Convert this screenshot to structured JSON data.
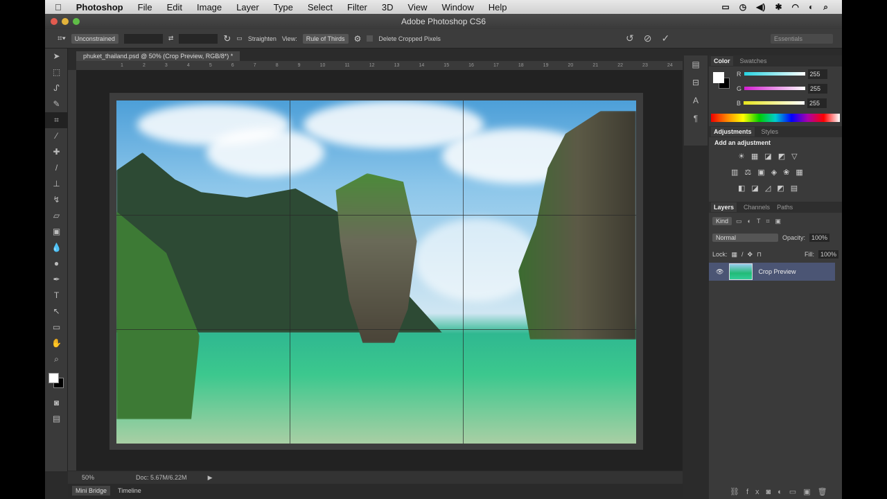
{
  "menubar": {
    "apple": "",
    "app": "Photoshop",
    "items": [
      "File",
      "Edit",
      "Image",
      "Layer",
      "Type",
      "Select",
      "Filter",
      "3D",
      "View",
      "Window",
      "Help"
    ],
    "status_icons": [
      "▭",
      "◷",
      "◀)",
      "✱",
      "◠",
      "◐",
      "⌕"
    ]
  },
  "window": {
    "title": "Adobe Photoshop CS6"
  },
  "options": {
    "ratio": "Unconstrained",
    "straighten": "Straighten",
    "view_label": "View:",
    "view_value": "Rule of Thirds",
    "delete_cropped": "Delete Cropped Pixels",
    "workspace": "Essentials"
  },
  "document": {
    "tab": "phuket_thailand.psd @ 50% (Crop Preview, RGB/8*) *",
    "ruler_ticks": [
      "1",
      "2",
      "3",
      "4",
      "5",
      "6",
      "7",
      "8",
      "9",
      "10",
      "11",
      "12",
      "13",
      "14",
      "15",
      "16",
      "17",
      "18",
      "19",
      "20",
      "21",
      "22",
      "23",
      "24"
    ]
  },
  "status": {
    "zoom": "50%",
    "doc": "Doc: 5.67M/6.22M"
  },
  "bottom_tabs": [
    "Mini Bridge",
    "Timeline"
  ],
  "color_panel": {
    "tabs": [
      "Color",
      "Swatches"
    ],
    "sliders": [
      {
        "label": "R",
        "value": "255",
        "color": "#27d3e0"
      },
      {
        "label": "G",
        "value": "255",
        "color": "#d31ed0"
      },
      {
        "label": "B",
        "value": "255",
        "color": "#e6e41e"
      }
    ]
  },
  "adjustments_panel": {
    "tabs": [
      "Adjustments",
      "Styles"
    ],
    "heading": "Add an adjustment"
  },
  "layers_panel": {
    "tabs": [
      "Layers",
      "Channels",
      "Paths"
    ],
    "kind": "Kind",
    "blend": "Normal",
    "opacity_label": "Opacity:",
    "opacity": "100%",
    "lock_label": "Lock:",
    "fill_label": "Fill:",
    "fill": "100%",
    "layer_name": "Crop Preview"
  }
}
